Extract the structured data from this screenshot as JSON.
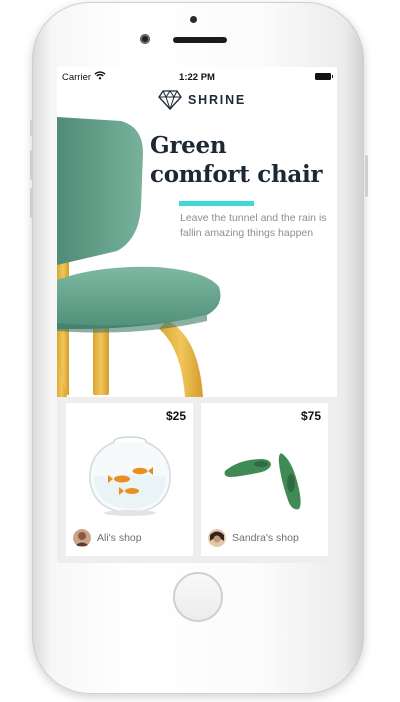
{
  "device": {
    "type": "iPhone mockup"
  },
  "status_bar": {
    "carrier": "Carrier",
    "wifi_icon": "wifi-icon",
    "time": "1:22 PM",
    "battery_icon": "battery-icon"
  },
  "header": {
    "logo_icon": "diamond-icon",
    "brand_name": "SHRINE"
  },
  "hero": {
    "title_line1": "Green",
    "title_line2": "comfort chair",
    "description": "Leave the tunnel and the rain is fallin amazing things happen",
    "accent_color": "#3fd8d8",
    "pager": {
      "count": 3,
      "active_index": 2
    }
  },
  "products": [
    {
      "price": "$25",
      "image": "fishbowl-with-goldfish",
      "shop": "Ali's shop"
    },
    {
      "price": "$75",
      "image": "green-flat-shoes",
      "shop": "Sandra's shop"
    }
  ]
}
